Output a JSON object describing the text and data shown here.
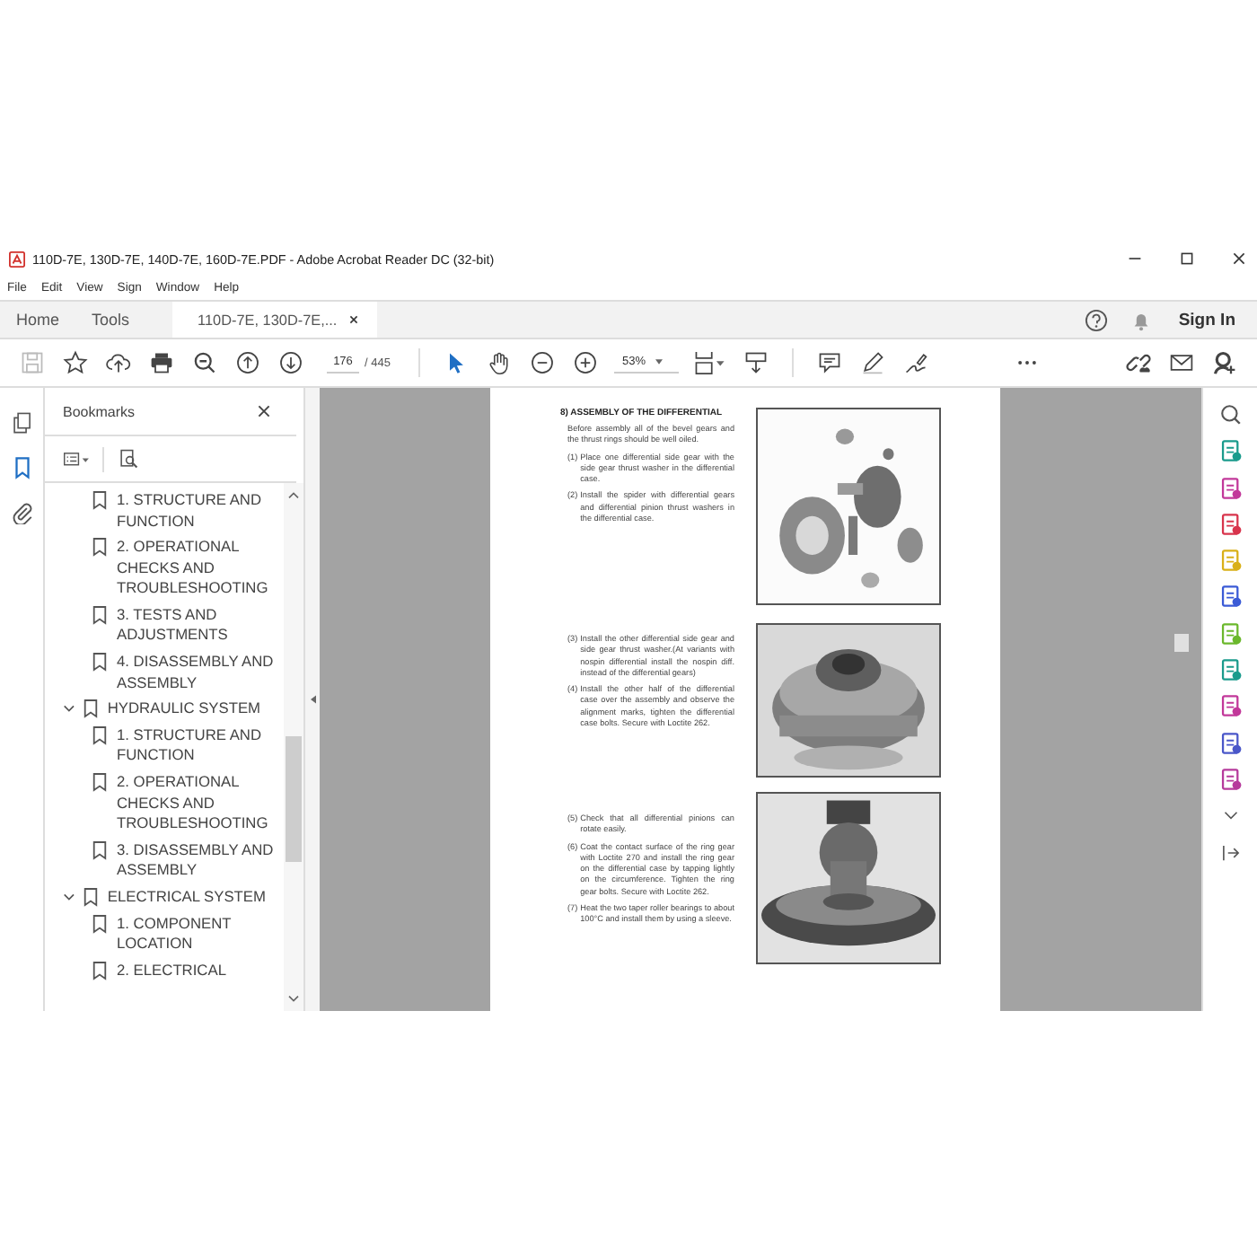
{
  "window": {
    "title": "110D-7E, 130D-7E, 140D-7E, 160D-7E.PDF - Adobe Acrobat Reader DC (32-bit)"
  },
  "menu": [
    "File",
    "Edit",
    "View",
    "Sign",
    "Window",
    "Help"
  ],
  "tabs": [
    {
      "label": "Home",
      "selected": false,
      "closable": false
    },
    {
      "label": "Tools",
      "selected": false,
      "closable": false
    },
    {
      "label": "110D-7E, 130D-7E,...",
      "selected": true,
      "closable": true
    }
  ],
  "account": {
    "sign_in": "Sign In"
  },
  "toolbar": {
    "page_current": "176",
    "page_total": "/ 445",
    "zoom": "53%"
  },
  "bookmarks_panel": {
    "title": "Bookmarks",
    "items": [
      {
        "children": [
          {
            "label": "1. STRUCTURE AND FUNCTION"
          },
          {
            "label": "2. OPERATIONAL CHECKS AND TROUBLESHOOTING"
          },
          {
            "label": "3. TESTS AND ADJUSTMENTS"
          },
          {
            "label": "4. DISASSEMBLY AND ASSEMBLY"
          }
        ]
      },
      {
        "label": "HYDRAULIC SYSTEM",
        "expanded": true,
        "children": [
          {
            "label": "1. STRUCTURE AND FUNCTION"
          },
          {
            "label": "2. OPERATIONAL CHECKS AND TROUBLESHOOTING"
          },
          {
            "label": "3. DISASSEMBLY AND ASSEMBLY"
          }
        ]
      },
      {
        "label": "ELECTRICAL SYSTEM",
        "expanded": true,
        "children": [
          {
            "label": "1. COMPONENT LOCATION"
          },
          {
            "label": "2. ELECTRICAL"
          }
        ]
      }
    ]
  },
  "document_page": {
    "sections": [
      {
        "heading": "8) ASSEMBLY OF THE DIFFERENTIAL",
        "paragraphs": [
          {
            "text": "Before assembly all of the bevel gears and the thrust rings should be well oiled."
          },
          {
            "marker": "(1)",
            "text": "Place one differential side gear with the side gear thrust washer in the differential case."
          },
          {
            "marker": "(2)",
            "text": "Install the spider with differential gears and differential pinion thrust washers in the differential case."
          }
        ],
        "photo": {
          "kind": "picture"
        }
      },
      {
        "paragraphs": [
          {
            "marker": "(3)",
            "text": "Install the other differential side gear and side gear thrust washer.(At variants with nospin differential install the nospin diff. instead of the differential gears)"
          },
          {
            "marker": "(4)",
            "text": "Install the other half of the differential case over the assembly and observe the alignment marks, tighten the differential case bolts.  Secure with Loctite 262."
          }
        ],
        "photo": {
          "kind": "picture"
        }
      },
      {
        "paragraphs": [
          {
            "marker": "(5)",
            "text": "Check that all differential pinions can rotate easily."
          },
          {
            "marker": "(6)",
            "text": "Coat the contact surface of the ring gear with Loctite 270 and install the ring gear on the differential case by tapping lightly on the circumference.  Tighten the ring gear bolts.  Secure with Loctite 262."
          },
          {
            "marker": "(7)",
            "text": "Heat the two taper roller bearings to about 100°C and install them by using a sleeve."
          }
        ],
        "photo": {
          "kind": "picture"
        }
      }
    ]
  }
}
